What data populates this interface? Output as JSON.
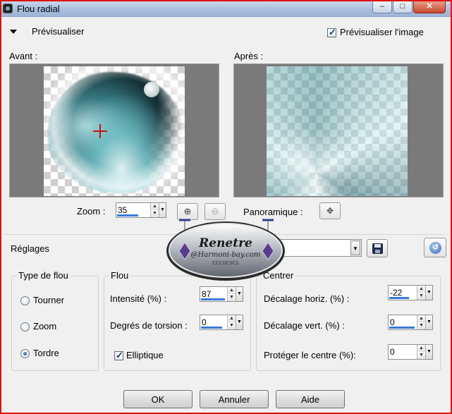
{
  "window": {
    "title": "Flou radial"
  },
  "titlebar_buttons": {
    "minimize": "–",
    "maximize": "□",
    "close": "✕"
  },
  "preview": {
    "section_label": "Prévisualiser",
    "checkbox_label": "Prévisualiser l'image",
    "checked": true,
    "before_label": "Avant :",
    "after_label": "Après :",
    "zoom_label": "Zoom :",
    "zoom_value": "35",
    "pan_label": "Panoramique :"
  },
  "presets": {
    "label": "Réglages",
    "value": ""
  },
  "blur_type": {
    "title": "Type de flou",
    "options": [
      "Tourner",
      "Zoom",
      "Tordre"
    ],
    "selected": "Tordre"
  },
  "blur": {
    "title": "Flou",
    "intensity_label": "Intensité (%) :",
    "intensity_value": "87",
    "twist_label": "Degrés de torsion :",
    "twist_value": "0",
    "elliptical_label": "Elliptique",
    "elliptical_checked": true
  },
  "center": {
    "title": "Centrer",
    "h_offset_label": "Décalage horiz. (%) :",
    "h_offset_value": "-22",
    "v_offset_label": "Décalage vert. (%) :",
    "v_offset_value": "0",
    "protect_label": "Protéger le centre (%):",
    "protect_value": "0"
  },
  "buttons": {
    "ok": "OK",
    "cancel": "Annuler",
    "help": "Aide"
  },
  "watermark": {
    "line1": "Renetre",
    "line2": "@Harmoni-bay.com",
    "line3": "CCC0CSC1"
  },
  "colors": {
    "accent": "#3979d5",
    "window_border": "#e01010",
    "titlebar": "#a9bedf"
  }
}
